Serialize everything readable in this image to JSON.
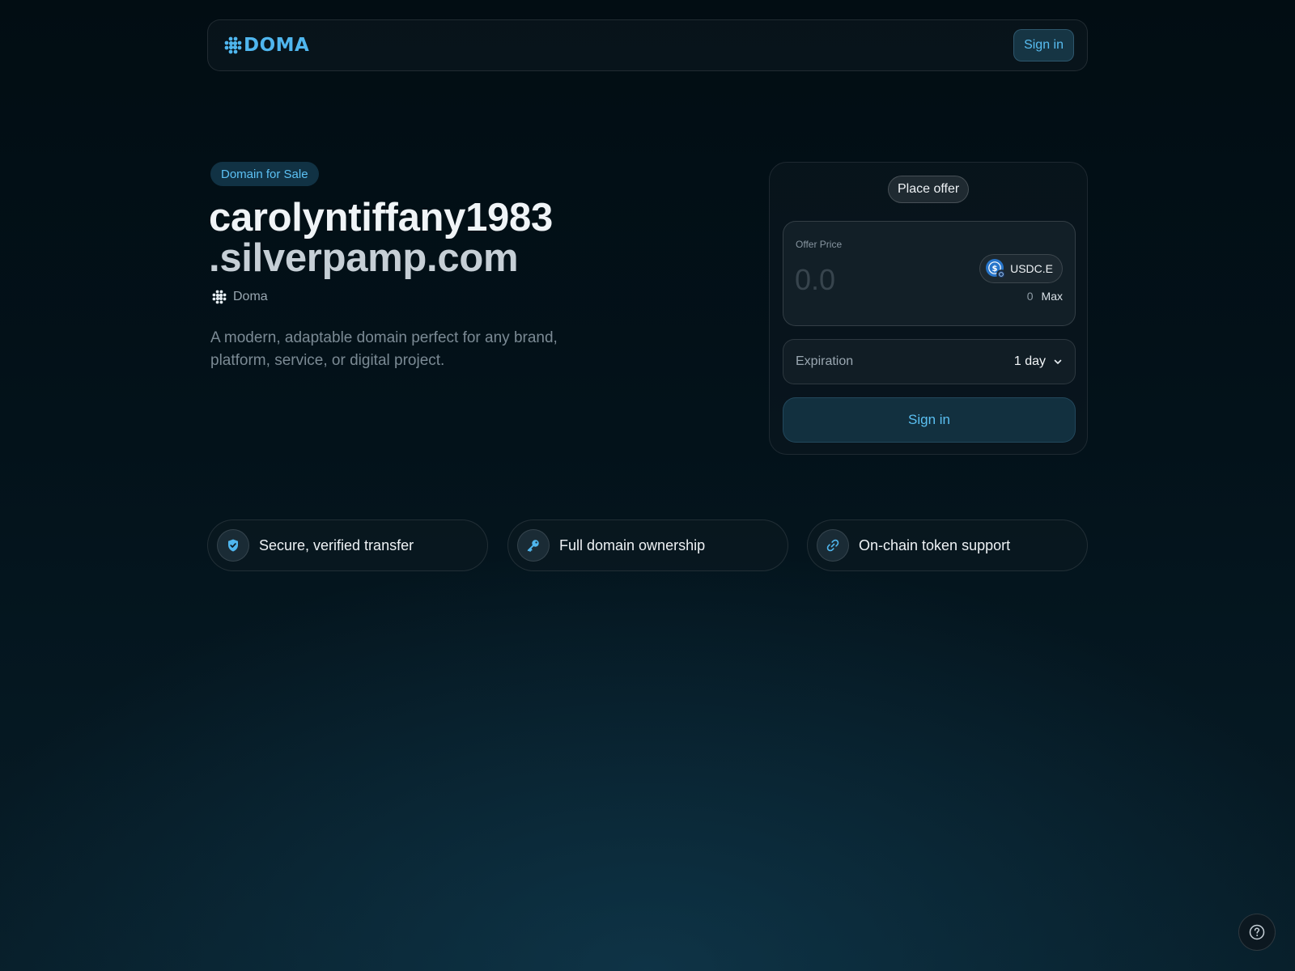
{
  "header": {
    "logo_text": "DOMA",
    "signin_label": "Sign in"
  },
  "hero": {
    "badge": "Domain for Sale",
    "domain_line1": "carolyntiffany1983",
    "domain_line2": ".silverpamp.com",
    "registrar": "Doma",
    "description": "A modern, adaptable domain perfect for any brand, platform, service, or digital project."
  },
  "offer": {
    "tab_label": "Place offer",
    "price_label": "Offer Price",
    "price_placeholder": "0.0",
    "token": "USDC.E",
    "balance": "0",
    "max_label": "Max",
    "expiration_label": "Expiration",
    "expiration_value": "1 day",
    "signin_label": "Sign in"
  },
  "features": [
    {
      "icon": "shield-check-icon",
      "label": "Secure, verified transfer"
    },
    {
      "icon": "key-icon",
      "label": "Full domain ownership"
    },
    {
      "icon": "link-icon",
      "label": "On-chain token support"
    }
  ],
  "help": {
    "icon": "help-circle-icon"
  },
  "colors": {
    "accent": "#4fb6ee",
    "background": "#020d13",
    "card": "#121f27"
  }
}
